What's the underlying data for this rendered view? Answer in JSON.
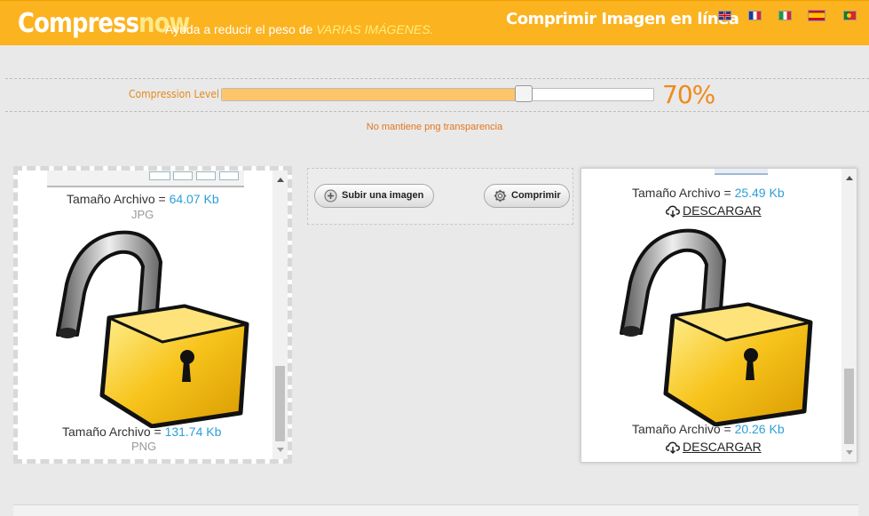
{
  "header": {
    "logo_part1": "Compress",
    "logo_part2": "now",
    "tagline": "Ayuda a reducir el peso de ",
    "tagline_highlight": "VARIAS IMÁGENES.",
    "title": "Comprimir Imagen en línea",
    "flags": [
      "uk-flag-icon",
      "france-flag-icon",
      "italy-flag-icon",
      "spain-flag-icon",
      "portugal-flag-icon"
    ]
  },
  "compression": {
    "label": "Compression Level",
    "percent_text": "70%",
    "level": 0.7,
    "note": "No mantiene png transparencia"
  },
  "colors": {
    "accent": "#fbb320",
    "value_blue": "#2d9fd9",
    "orange_text": "#e58a1b"
  },
  "original": {
    "items": [
      {
        "size_label": "Tamaño Archivo = ",
        "size_value": "64.07 Kb",
        "format": "JPG"
      },
      {
        "size_label": "Tamaño Archivo = ",
        "size_value": "131.74 Kb",
        "format": "PNG"
      }
    ]
  },
  "compressed": {
    "items": [
      {
        "size_label": "Tamaño Archivo = ",
        "size_value": "25.49 Kb",
        "download": "DESCARGAR"
      },
      {
        "size_label": "Tamaño Archivo = ",
        "size_value": "20.26 Kb",
        "download": "DESCARGAR"
      }
    ]
  },
  "actions": {
    "upload_label": "Subir una imagen",
    "compress_label": "Comprimir"
  }
}
